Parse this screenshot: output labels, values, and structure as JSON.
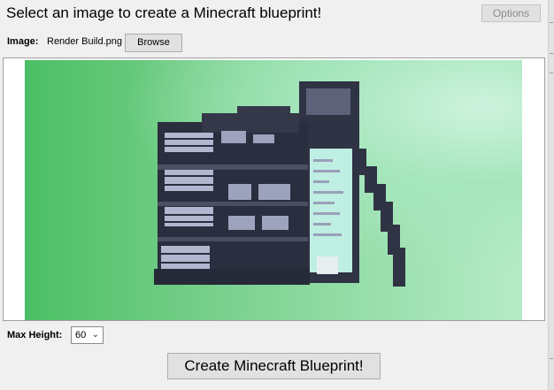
{
  "header": {
    "title": "Select an image to create a Minecraft blueprint!",
    "options_label": "Options"
  },
  "image_row": {
    "label": "Image:",
    "filename": "Render Build.png",
    "browse_label": "Browse"
  },
  "preview": {
    "description_colors": {
      "background_left": "#4bbf65",
      "background_right": "#b6ebc7",
      "block_dark": "#2f3344",
      "block_light": "#b3b6cf",
      "glass": "#bfeee2"
    }
  },
  "max_height": {
    "label": "Max Height:",
    "value": "60",
    "chevron_icon": "chevron-down-icon"
  },
  "actions": {
    "create_label": "Create Minecraft Blueprint!"
  }
}
